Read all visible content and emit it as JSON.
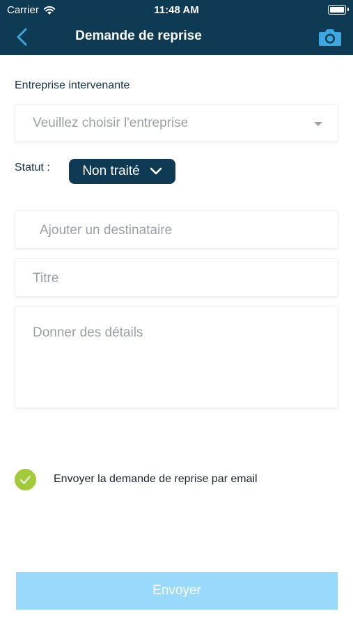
{
  "status_bar": {
    "carrier": "Carrier",
    "time": "11:48 AM"
  },
  "nav": {
    "title": "Demande de reprise"
  },
  "form": {
    "company_label": "Entreprise intervenante",
    "company_placeholder": "Veuillez choisir l'entreprise",
    "status_label": "Statut :",
    "status_value": "Non traité",
    "recipient_placeholder": "Ajouter un destinataire",
    "title_placeholder": "Titre",
    "details_placeholder": "Donner des détails",
    "email_option_label": "Envoyer la demande de reprise par email",
    "email_option_checked": true,
    "send_label": "Envoyer"
  },
  "colors": {
    "header": "#0e3a54",
    "accent": "#3da8e0",
    "check": "#a3ca3b",
    "send_button": "#99d9fb"
  }
}
